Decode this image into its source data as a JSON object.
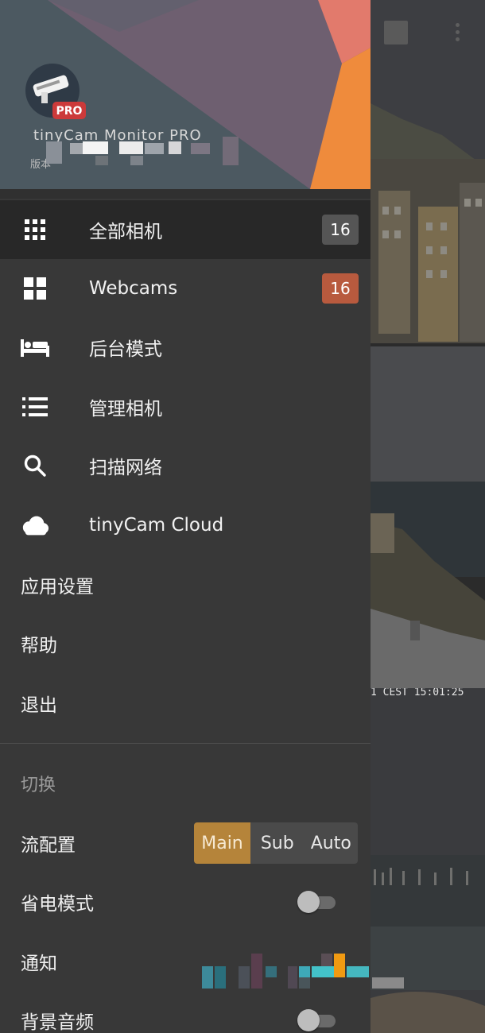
{
  "header": {
    "app_name": "tinyCam Monitor PRO",
    "version_label": "版本",
    "logo_badge": "PRO"
  },
  "nav": {
    "items": [
      {
        "label": "全部相机",
        "badge": "16",
        "icon": "grid-icon"
      },
      {
        "label": "Webcams",
        "badge": "16",
        "icon": "tiles-icon"
      },
      {
        "label": "后台模式",
        "icon": "bed-icon"
      },
      {
        "label": "管理相机",
        "icon": "list-icon"
      },
      {
        "label": "扫描网络",
        "icon": "search-icon"
      },
      {
        "label": "tinyCam Cloud",
        "icon": "cloud-icon"
      }
    ],
    "plain_items": [
      "应用设置",
      "帮助",
      "退出"
    ]
  },
  "switch_section": {
    "title": "切换",
    "stream_label": "流配置",
    "stream_options": [
      "Main",
      "Sub",
      "Auto"
    ],
    "stream_selected": "Main",
    "power_saving_label": "省电模式",
    "power_saving_on": false,
    "notification_label": "通知",
    "background_audio_label": "背景音频",
    "background_audio_on": false
  },
  "camera_overlay": {
    "timestamp": "1 CEST 15:01:25"
  },
  "colors": {
    "drawer_bg": "#383838",
    "active_item_bg": "#282828",
    "badge_all": "#555555",
    "badge_webcams": "#b85a3e",
    "accent_selected": "#b5843a"
  }
}
